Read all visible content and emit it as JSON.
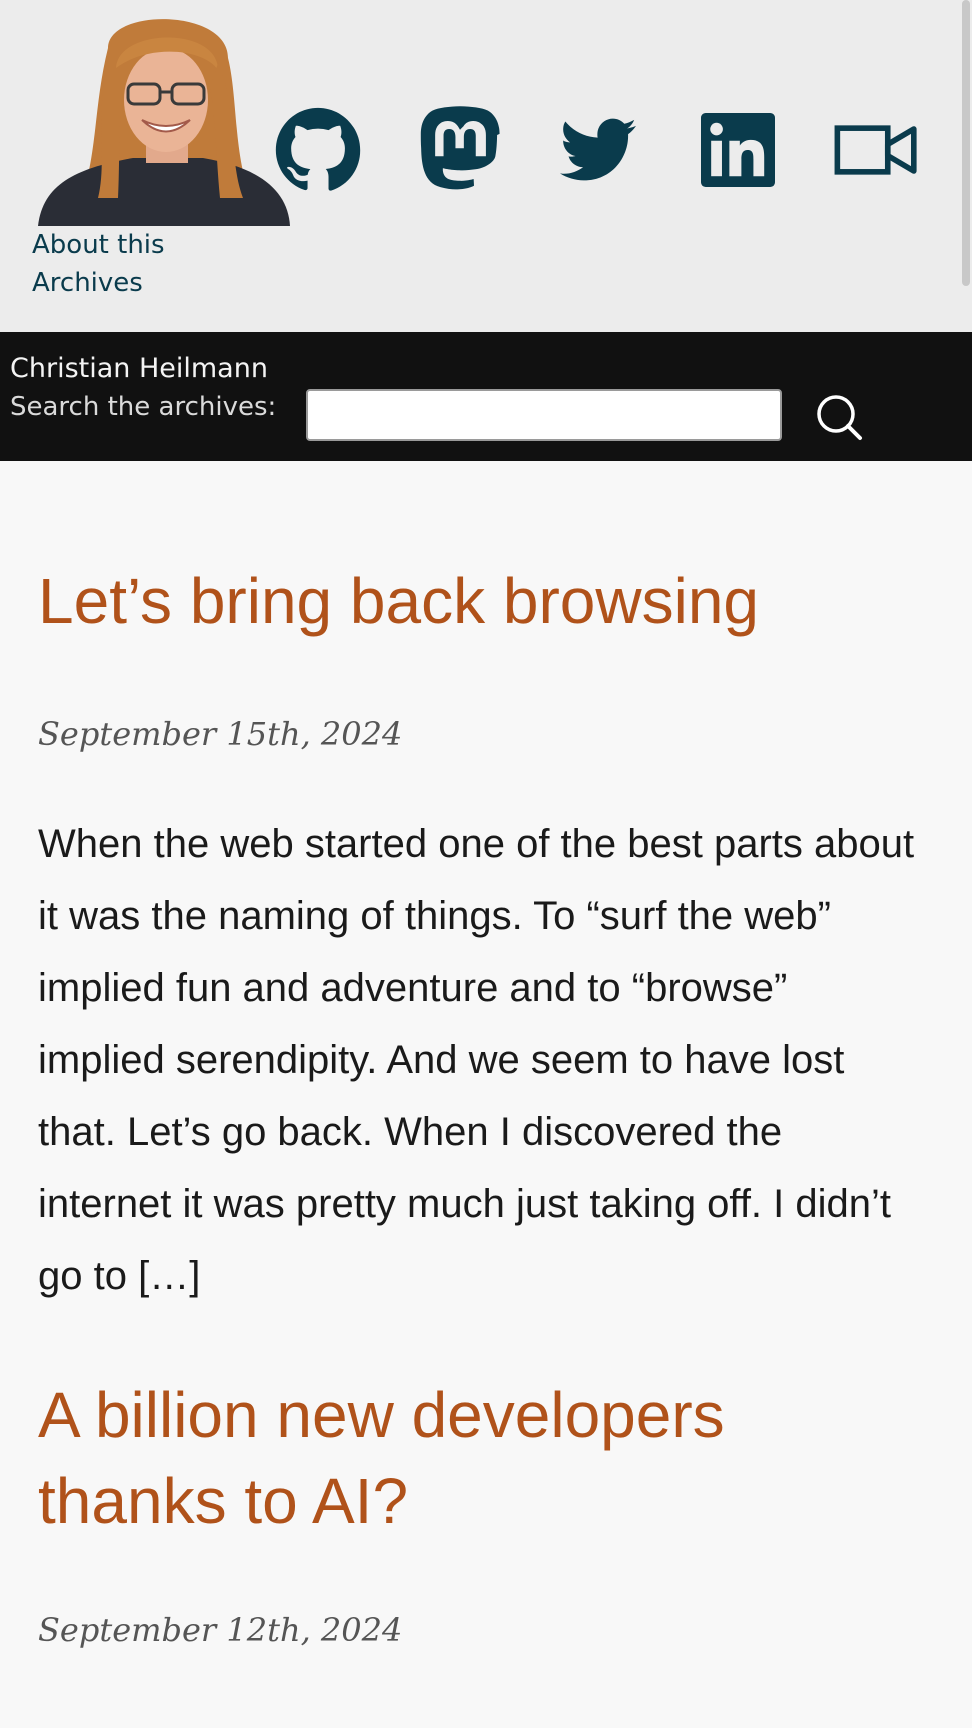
{
  "header": {
    "nav": [
      {
        "label": "About this"
      },
      {
        "label": "Archives"
      }
    ],
    "social": [
      {
        "icon": "github-icon"
      },
      {
        "icon": "mastodon-icon"
      },
      {
        "icon": "twitter-icon"
      },
      {
        "icon": "linkedin-icon"
      },
      {
        "icon": "video-camera-icon"
      }
    ],
    "icon_color": "#0a3b4c"
  },
  "bar": {
    "site_title": "Christian Heilmann",
    "search_label": "Search the archives:",
    "search_value": "",
    "search_icon": "search-icon"
  },
  "posts": [
    {
      "title": "Let’s bring back browsing",
      "date": "September 15th, 2024",
      "excerpt": "When the web started one of the best parts about it was the naming of things. To “surf the web” implied fun and adventure and to “browse” implied serendipity. And we seem to have lost that. Let’s go back. When I discovered the internet it was pretty much just taking off. I didn’t go to […]"
    },
    {
      "title": "A billion new developers thanks to AI?",
      "date": "September 12th, 2024",
      "excerpt": ""
    }
  ],
  "colors": {
    "title": "#b0521a",
    "link": "#0a3b4c",
    "bar": "#111111",
    "header_bg": "#ececec",
    "page_bg": "#f8f8f8"
  }
}
